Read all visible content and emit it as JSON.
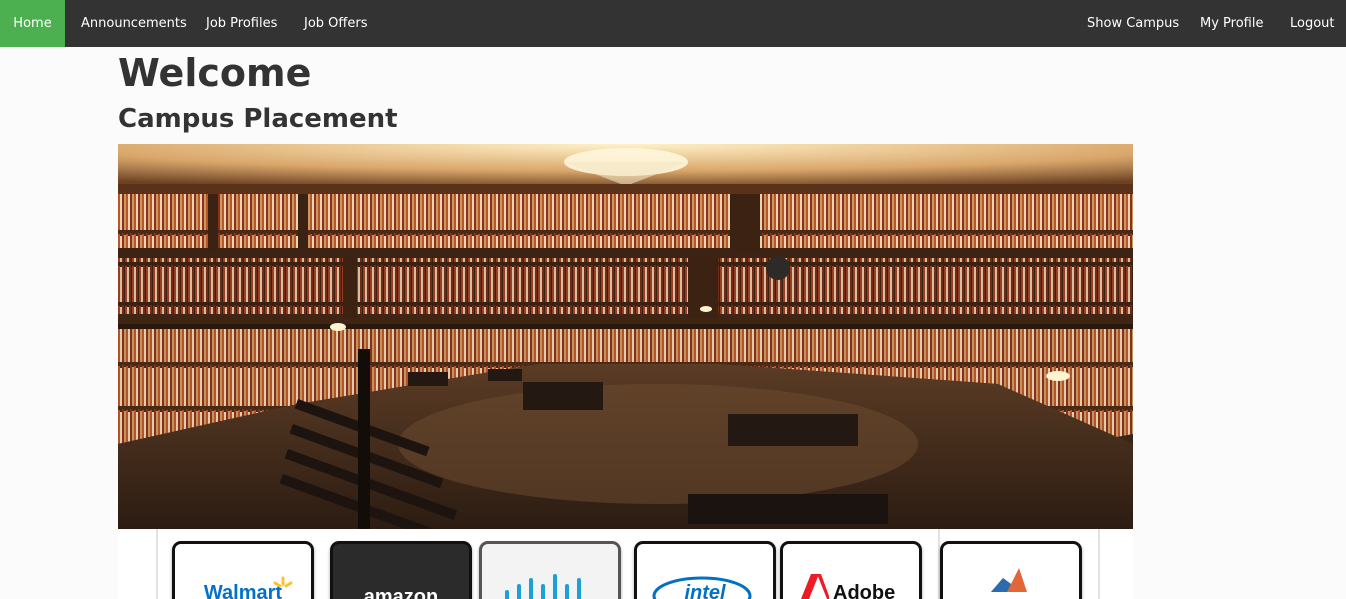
{
  "nav": {
    "left": [
      {
        "label": "Home",
        "active": true
      },
      {
        "label": "Announcements"
      },
      {
        "label": "Job Profiles"
      },
      {
        "label": "Job Offers"
      }
    ],
    "right": [
      {
        "label": "Show Campus"
      },
      {
        "label": "My Profile"
      },
      {
        "label": "Logout"
      }
    ]
  },
  "main": {
    "title": "Welcome",
    "subtitle": "Campus Placement"
  },
  "hero": {
    "icon": "library-image"
  },
  "logos": [
    {
      "name": "Walmart",
      "text": "Walmart",
      "color": "#0071ce",
      "bg": "#ffffff"
    },
    {
      "name": "Amazon",
      "text": "amazon",
      "color": "#ffffff",
      "bg": "#2b2b2b"
    },
    {
      "name": "Cisco",
      "text": "",
      "color": "#1ba0d7",
      "bg": "#f3f3f3"
    },
    {
      "name": "Intel",
      "text": "intel",
      "color": "#0071c5",
      "bg": "#ffffff"
    },
    {
      "name": "Adobe",
      "text": "Adobe",
      "color": "#ed1c24",
      "bg": "#ffffff"
    },
    {
      "name": "MathWorks",
      "text": "",
      "color": "#e16737",
      "bg": "#ffffff"
    }
  ],
  "colors": {
    "navbar": "#333333",
    "active": "#4CAF50"
  }
}
